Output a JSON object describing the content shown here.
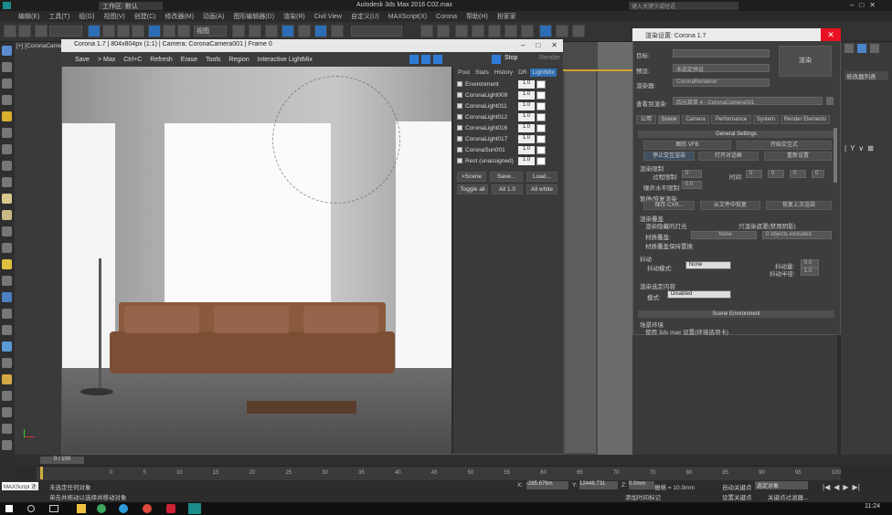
{
  "app": {
    "workspace": "工作区: 默认",
    "title": "Autodesk 3ds Max 2016    C02.max",
    "search_placeholder": "键入关键字或短语",
    "menu": [
      "编辑(E)",
      "工具(T)",
      "组(G)",
      "视图(V)",
      "创建(C)",
      "修改器(M)",
      "动画(A)",
      "图形编辑器(D)",
      "渲染(R)",
      "Civil View",
      "自定义(U)",
      "MAXScript(X)",
      "Corona",
      "帮助(H)",
      "扮家家"
    ],
    "selection_dropdown": "视图"
  },
  "viewport": {
    "label": "[+] [CoronaCamera001]"
  },
  "vfb": {
    "title": "Corona 1.7 | 804x804px (1:1) | Camera: CoronaCamera001 | Frame 0",
    "toolbar": [
      "Save",
      "> Max",
      "Ctrl+C",
      "Refresh",
      "Erase",
      "Tools",
      "Region",
      "Interactive LightMix"
    ],
    "stop": "Stop",
    "render": "Render",
    "tabs": [
      "Post",
      "Stats",
      "History",
      "DR",
      "LightMix"
    ],
    "lights": [
      {
        "name": "Environment",
        "value": "1.0"
      },
      {
        "name": "CoronaLight009",
        "value": "1.0"
      },
      {
        "name": "CoronaLight011",
        "value": "1.0"
      },
      {
        "name": "CoronaLight012",
        "value": "1.0"
      },
      {
        "name": "CoronaLight016",
        "value": "1.0"
      },
      {
        "name": "CoronaLight017",
        "value": "1.0"
      },
      {
        "name": "CoronaSun001",
        "value": "1.0"
      },
      {
        "name": "Rest (unassigned)",
        "value": "1.0"
      }
    ],
    "btn_scene": ">Scene",
    "btn_save": "Save...",
    "btn_load": "Load...",
    "btn_toggle": "Toggle all",
    "btn_all": "All 1.0",
    "btn_white": "All white"
  },
  "render_setup": {
    "title": "渲染设置: Corona 1.7",
    "target_label": "目标:",
    "preset_label": "预设:",
    "preset_value": "未选定预设",
    "renderer_label": "渲染器:",
    "renderer_value": "CoronaRenderer",
    "view_label": "查看到渲染:",
    "view_value": "四元菜单 4 - CoronaCamera001",
    "render_btn": "渲染",
    "tabs": [
      "公用",
      "Scene",
      "Camera",
      "Performance",
      "System",
      "Render Elements"
    ],
    "general_settings": "General Settings",
    "gs_buttons": [
      "图形 VFB",
      "开始交互式",
      "停止交互渲染",
      "打开对话框",
      "重新设置"
    ],
    "limit_label": "渲染限制",
    "pass_limit": "过程限制:",
    "pass_val": "0",
    "time_label": "时间:",
    "time_vals": [
      "0",
      "0",
      "0",
      "0"
    ],
    "noise_label": "噪声水平限制:",
    "noise_val": "0.0",
    "resume_label": "暂停/恢复渲染",
    "resume_btns": [
      "保存 CXR...",
      "从文件中恢复",
      "恢复上次渲染"
    ],
    "override_label": "渲染覆盖",
    "override_items": [
      "渲染隐藏的灯光",
      "只渲染遮罩(禁用阴影)",
      "材质覆盖:",
      "材质覆盖保持置换"
    ],
    "override_none": "None",
    "override_excluded": "0 objects excluded",
    "dither_label": "抖动",
    "dither_mode_label": "抖动模式:",
    "dither_mode_value": "None",
    "dither_amount_label": "抖动量:",
    "dither_amount_val": "0.0",
    "dither_radius_label": "抖动半径:",
    "dither_radius_val": "1.0",
    "select_label": "渲染选定内容",
    "mode_label": "模式:",
    "mode_value": "Disabled",
    "scene_env": "Scene Environment",
    "scene_env_sub": "场景环境",
    "use_max": "使用 3ds max 设置(环境选项卡)"
  },
  "timeline": {
    "frame": "0 / 100",
    "ticks": [
      "0",
      "5",
      "10",
      "15",
      "20",
      "25",
      "30",
      "35",
      "40",
      "45",
      "50",
      "55",
      "60",
      "65",
      "70",
      "75",
      "80",
      "85",
      "90",
      "95",
      "100"
    ]
  },
  "status": {
    "msg1": "未选定任何对象",
    "msg2": "单击并拖动以选择并移动对象",
    "maxscript": "MAXScript 迷",
    "x_label": "X:",
    "x_val": "-285.676m",
    "y_label": "Y:",
    "y_val": "12448.731",
    "z_label": "Z:",
    "z_val": "0.0mm",
    "grid": "栅格 = 10.0mm",
    "time_tag": "添加时间标记",
    "autokey": "自动关键点",
    "selected": "选定对象",
    "setkey": "设置关键点",
    "keyfilter": "关键点过滤器..."
  },
  "taskbar": {
    "clock": "11:24"
  },
  "right_panel": {
    "label": "修改器列表"
  }
}
